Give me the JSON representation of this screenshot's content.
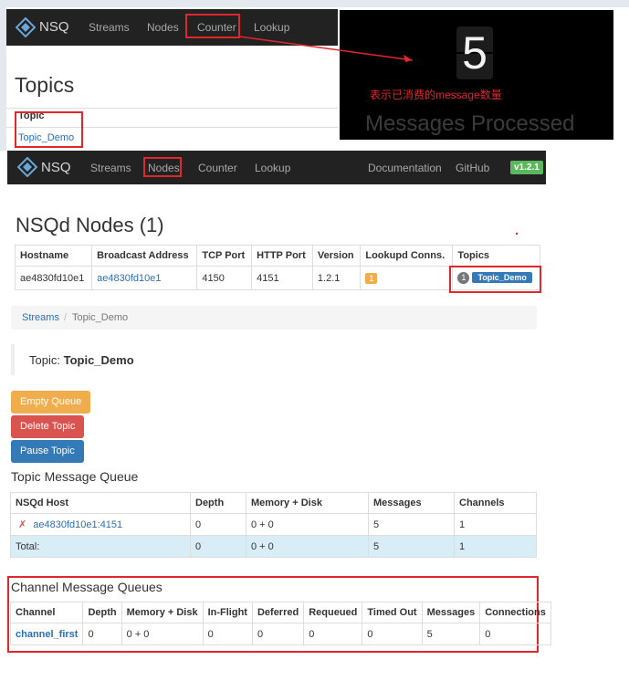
{
  "nav1": {
    "brand": "NSQ",
    "items": [
      "Streams",
      "Nodes",
      "Counter",
      "Lookup"
    ]
  },
  "topics_page": {
    "title": "Topics",
    "col_header": "Topic",
    "topic": "Topic_Demo"
  },
  "counter": {
    "digit": "5",
    "annotation": "表示已消费的message数量",
    "caption": "Messages Processed"
  },
  "nav2": {
    "brand": "NSQ",
    "items": [
      "Streams",
      "Nodes",
      "Counter",
      "Lookup"
    ],
    "right": [
      "Documentation",
      "GitHub"
    ],
    "version": "v1.2.1"
  },
  "nodes": {
    "title": "NSQd Nodes (1)",
    "headers": [
      "Hostname",
      "Broadcast Address",
      "TCP Port",
      "HTTP Port",
      "Version",
      "Lookupd Conns.",
      "Topics"
    ],
    "row": {
      "hostname": "ae4830fd10e1",
      "broadcast": "ae4830fd10e1",
      "tcp": "4150",
      "http": "4151",
      "version": "1.2.1",
      "lookupd": "1",
      "topic_count": "1",
      "topic": "Topic_Demo"
    }
  },
  "breadcrumb": {
    "parent": "Streams",
    "sep": "/",
    "current": "Topic_Demo"
  },
  "topic_header": {
    "label": "Topic:",
    "name": "Topic_Demo"
  },
  "buttons": {
    "empty": "Empty Queue",
    "delete": "Delete Topic",
    "pause": "Pause Topic"
  },
  "tmq": {
    "title": "Topic Message Queue",
    "headers": [
      "NSQd Host",
      "Depth",
      "Memory + Disk",
      "Messages",
      "Channels"
    ],
    "row": {
      "mark": "✗",
      "host": "ae4830fd10e1:4151",
      "depth": "0",
      "mem": "0 + 0",
      "messages": "5",
      "channels": "1"
    },
    "total": {
      "label": "Total:",
      "depth": "0",
      "mem": "0 + 0",
      "messages": "5",
      "channels": "1"
    }
  },
  "cmq": {
    "title": "Channel Message Queues",
    "headers": [
      "Channel",
      "Depth",
      "Memory + Disk",
      "In-Flight",
      "Deferred",
      "Requeued",
      "Timed Out",
      "Messages",
      "Connections"
    ],
    "row": {
      "channel": "channel_first",
      "depth": "0",
      "mem": "0 + 0",
      "inflight": "0",
      "deferred": "0",
      "requeued": "0",
      "timedout": "0",
      "messages": "5",
      "connections": "0"
    }
  },
  "colors": {
    "red_box": "#e0272c",
    "navbar": "#222222",
    "link": "#2a6fb5",
    "empty_btn": "#f0ad4e",
    "delete_btn": "#d9534f",
    "pause_btn": "#337ab7",
    "version_badge": "#5cb85c",
    "lookupd_badge": "#f0ad4e"
  }
}
